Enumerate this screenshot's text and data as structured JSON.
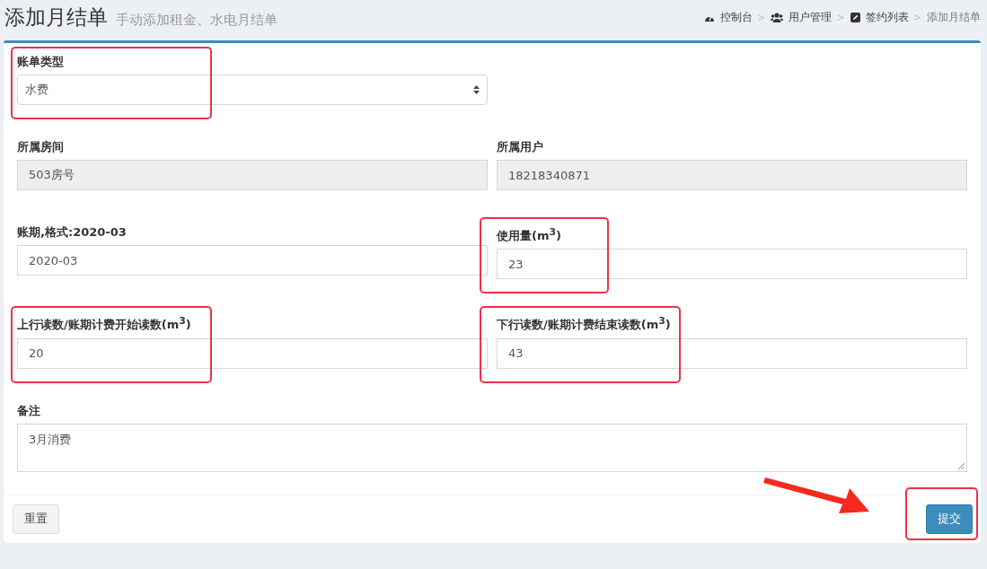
{
  "page": {
    "title": "添加月结单",
    "subtitle": "手动添加租金、水电月结单"
  },
  "breadcrumb": {
    "separator": ">",
    "items": [
      {
        "label": "控制台",
        "active": false
      },
      {
        "label": "用户管理",
        "active": false
      },
      {
        "label": "签约列表",
        "active": false
      },
      {
        "label": "添加月结单",
        "active": true
      }
    ]
  },
  "form": {
    "rows": [
      [
        {
          "kind": "select",
          "label": "账单类型",
          "value": "水费",
          "disabled": false,
          "highlighted": true
        }
      ],
      [
        {
          "kind": "input",
          "label": "所属房间",
          "value": "503房号",
          "disabled": true,
          "highlighted": false
        },
        {
          "kind": "input",
          "label": "所属用户",
          "value": "18218340871",
          "disabled": true,
          "highlighted": false
        }
      ],
      [
        {
          "kind": "input",
          "label": "账期,格式:2020-03",
          "value": "2020-03",
          "disabled": false,
          "highlighted": false
        },
        {
          "kind": "input",
          "label": "使用量(m$^{3}$)",
          "value": "23",
          "disabled": false,
          "highlighted": true
        }
      ],
      [
        {
          "kind": "input",
          "label": "上行读数/账期计费开始读数(m$^{3}$)",
          "value": "20",
          "disabled": false,
          "highlighted": true
        },
        {
          "kind": "input",
          "label": "下行读数/账期计费结束读数(m$^{3}$)",
          "value": "43",
          "disabled": false,
          "highlighted": true
        }
      ],
      [
        {
          "kind": "textarea",
          "label": "备注",
          "value": "3月消费",
          "disabled": false,
          "highlighted": false
        }
      ]
    ]
  },
  "footer": {
    "reset": {
      "label": "重置"
    },
    "submit": {
      "label": "提交",
      "highlighted": true,
      "arrow": true
    }
  }
}
